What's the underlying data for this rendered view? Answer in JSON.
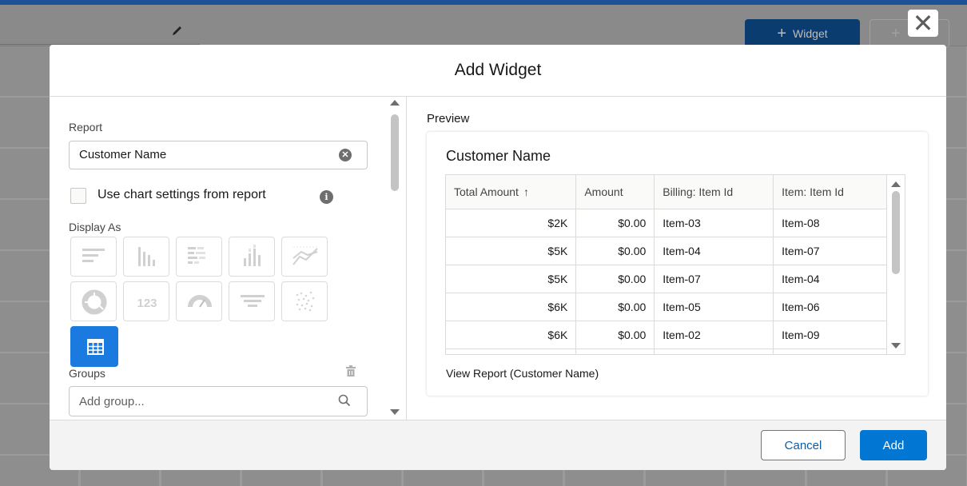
{
  "background": {
    "widget_button_label": "Widget",
    "widget_button_plus": "+",
    "filter_button_plus": "+",
    "close_glyph": "✕"
  },
  "modal": {
    "title": "Add Widget",
    "left": {
      "report_label": "Report",
      "report_value": "Customer Name",
      "use_chart_settings_label": "Use chart settings from report",
      "use_chart_settings_checked": false,
      "display_as_label": "Display As",
      "chart_types": [
        {
          "icon": "horizontal-bar-chart-icon",
          "selected": false
        },
        {
          "icon": "vertical-bar-chart-icon",
          "selected": false
        },
        {
          "icon": "stacked-horizontal-bar-chart-icon",
          "selected": false
        },
        {
          "icon": "stacked-vertical-bar-chart-icon",
          "selected": false
        },
        {
          "icon": "line-chart-icon",
          "selected": false
        },
        {
          "icon": "donut-chart-icon",
          "selected": false
        },
        {
          "icon": "metric-icon",
          "label": "123",
          "selected": false
        },
        {
          "icon": "gauge-icon",
          "selected": false
        },
        {
          "icon": "funnel-icon",
          "selected": false
        },
        {
          "icon": "scatter-chart-icon",
          "selected": false
        },
        {
          "icon": "table-icon",
          "selected": true
        }
      ],
      "groups_label": "Groups",
      "group_placeholder": "Add group..."
    },
    "preview": {
      "label": "Preview",
      "title": "Customer Name",
      "columns": [
        "Total Amount",
        "Amount",
        "Billing: Item Id",
        "Item: Item Id"
      ],
      "sort_glyph": "↑",
      "rows": [
        [
          "$2K",
          "$0.00",
          "Item-03",
          "Item-08"
        ],
        [
          "$5K",
          "$0.00",
          "Item-04",
          "Item-07"
        ],
        [
          "$5K",
          "$0.00",
          "Item-07",
          "Item-04"
        ],
        [
          "$6K",
          "$0.00",
          "Item-05",
          "Item-06"
        ],
        [
          "$6K",
          "$0.00",
          "Item-02",
          "Item-09"
        ]
      ],
      "view_report_link": "View Report (Customer Name)"
    },
    "footer": {
      "cancel_label": "Cancel",
      "add_label": "Add"
    }
  },
  "colors": {
    "brand_blue": "#0176d3",
    "selected_chart": "#1b7ae0",
    "overlay": "#8e8e8e"
  }
}
